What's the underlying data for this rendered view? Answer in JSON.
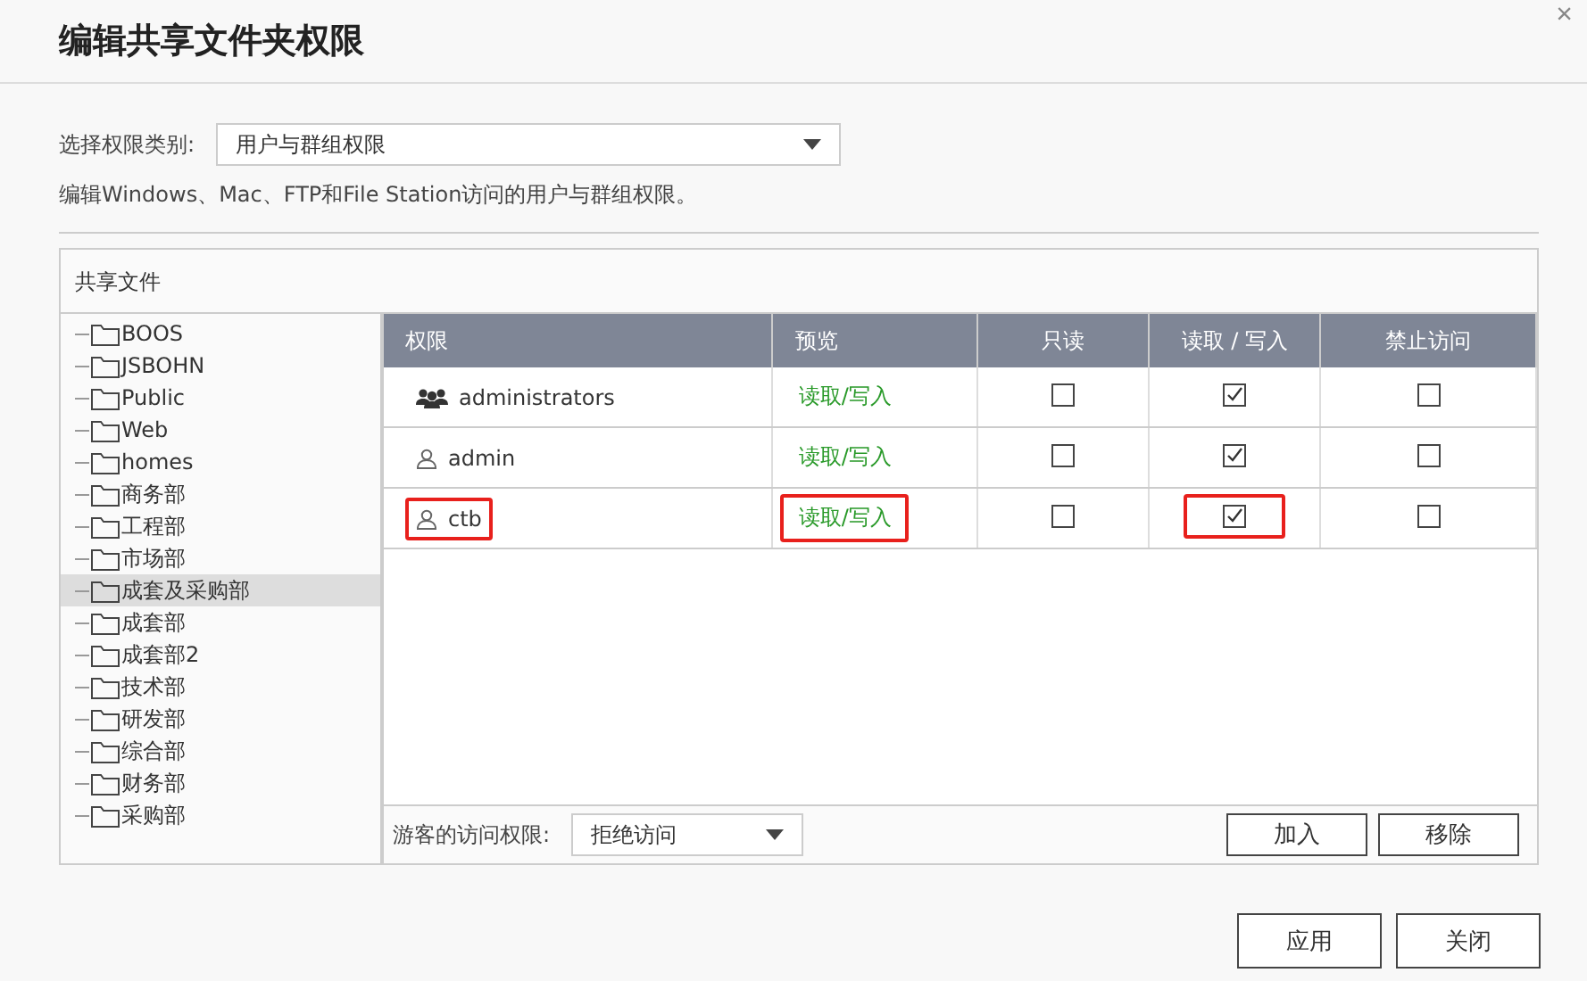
{
  "window": {
    "title": "编辑共享文件夹权限",
    "close": "×"
  },
  "permission_type": {
    "label": "选择权限类别:",
    "value": "用户与群组权限"
  },
  "description": "编辑Windows、Mac、FTP和File Station访问的用户与群组权限。",
  "panel": {
    "title": "共享文件"
  },
  "folders": [
    {
      "name": "BOOS",
      "selected": false
    },
    {
      "name": "JSBOHN",
      "selected": false
    },
    {
      "name": "Public",
      "selected": false
    },
    {
      "name": "Web",
      "selected": false
    },
    {
      "name": "homes",
      "selected": false
    },
    {
      "name": "商务部",
      "selected": false
    },
    {
      "name": "工程部",
      "selected": false
    },
    {
      "name": "市场部",
      "selected": false
    },
    {
      "name": "成套及采购部",
      "selected": true
    },
    {
      "name": "成套部",
      "selected": false
    },
    {
      "name": "成套部2",
      "selected": false
    },
    {
      "name": "技术部",
      "selected": false
    },
    {
      "name": "研发部",
      "selected": false
    },
    {
      "name": "综合部",
      "selected": false
    },
    {
      "name": "财务部",
      "selected": false
    },
    {
      "name": "采购部",
      "selected": false
    }
  ],
  "table": {
    "columns": [
      "权限",
      "预览",
      "只读",
      "读取 / 写入",
      "禁止访问"
    ],
    "rows": [
      {
        "kind": "group",
        "name": "administrators",
        "preview": "读取/写入",
        "read_only": false,
        "read_write": true,
        "deny": false,
        "highlighted": false
      },
      {
        "kind": "user",
        "name": "admin",
        "preview": "读取/写入",
        "read_only": false,
        "read_write": true,
        "deny": false,
        "highlighted": false
      },
      {
        "kind": "user",
        "name": "ctb",
        "preview": "读取/写入",
        "read_only": false,
        "read_write": true,
        "deny": false,
        "highlighted": true
      }
    ]
  },
  "guest_access": {
    "label": "游客的访问权限:",
    "value": "拒绝访问"
  },
  "table_buttons": [
    "加入",
    "移除"
  ],
  "footer_buttons": [
    "应用",
    "关闭"
  ]
}
